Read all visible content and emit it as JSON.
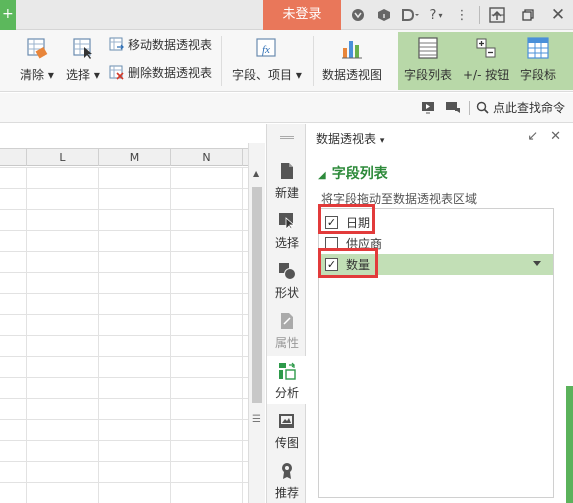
{
  "titlebar": {
    "tab_fragment": "+",
    "login_label": "未登录",
    "help_label": "?"
  },
  "ribbon": {
    "clear_label": "清除",
    "select_label": "选择",
    "move_pivot_label": "移动数据透视表",
    "delete_pivot_label": "删除数据透视表",
    "fields_items_label": "字段、项目",
    "pivot_chart_label": "数据透视图",
    "field_list_label": "字段列表",
    "plus_minus_label": "+/- 按钮",
    "field_header_label": "字段标"
  },
  "subbar": {
    "find_label": "点此查找命令"
  },
  "sheet": {
    "columns": [
      "L",
      "M",
      "N"
    ]
  },
  "strip": {
    "new_label": "新建",
    "select_label": "选择",
    "shape_label": "形状",
    "properties_label": "属性",
    "analyze_label": "分析",
    "image_label": "传图",
    "recommend_label": "推荐"
  },
  "panel": {
    "title": "数据透视表",
    "section_title": "字段列表",
    "hint": "将字段拖动至数据透视表区域",
    "fields": [
      {
        "label": "日期",
        "checked": true
      },
      {
        "label": "供应商",
        "checked": false
      },
      {
        "label": "数量",
        "checked": true
      }
    ]
  },
  "colors": {
    "accent_green": "#2d8a3a",
    "login_bg": "#e9775a",
    "highlight_red": "#e23b3b",
    "selected_row": "#c2dfb6"
  }
}
